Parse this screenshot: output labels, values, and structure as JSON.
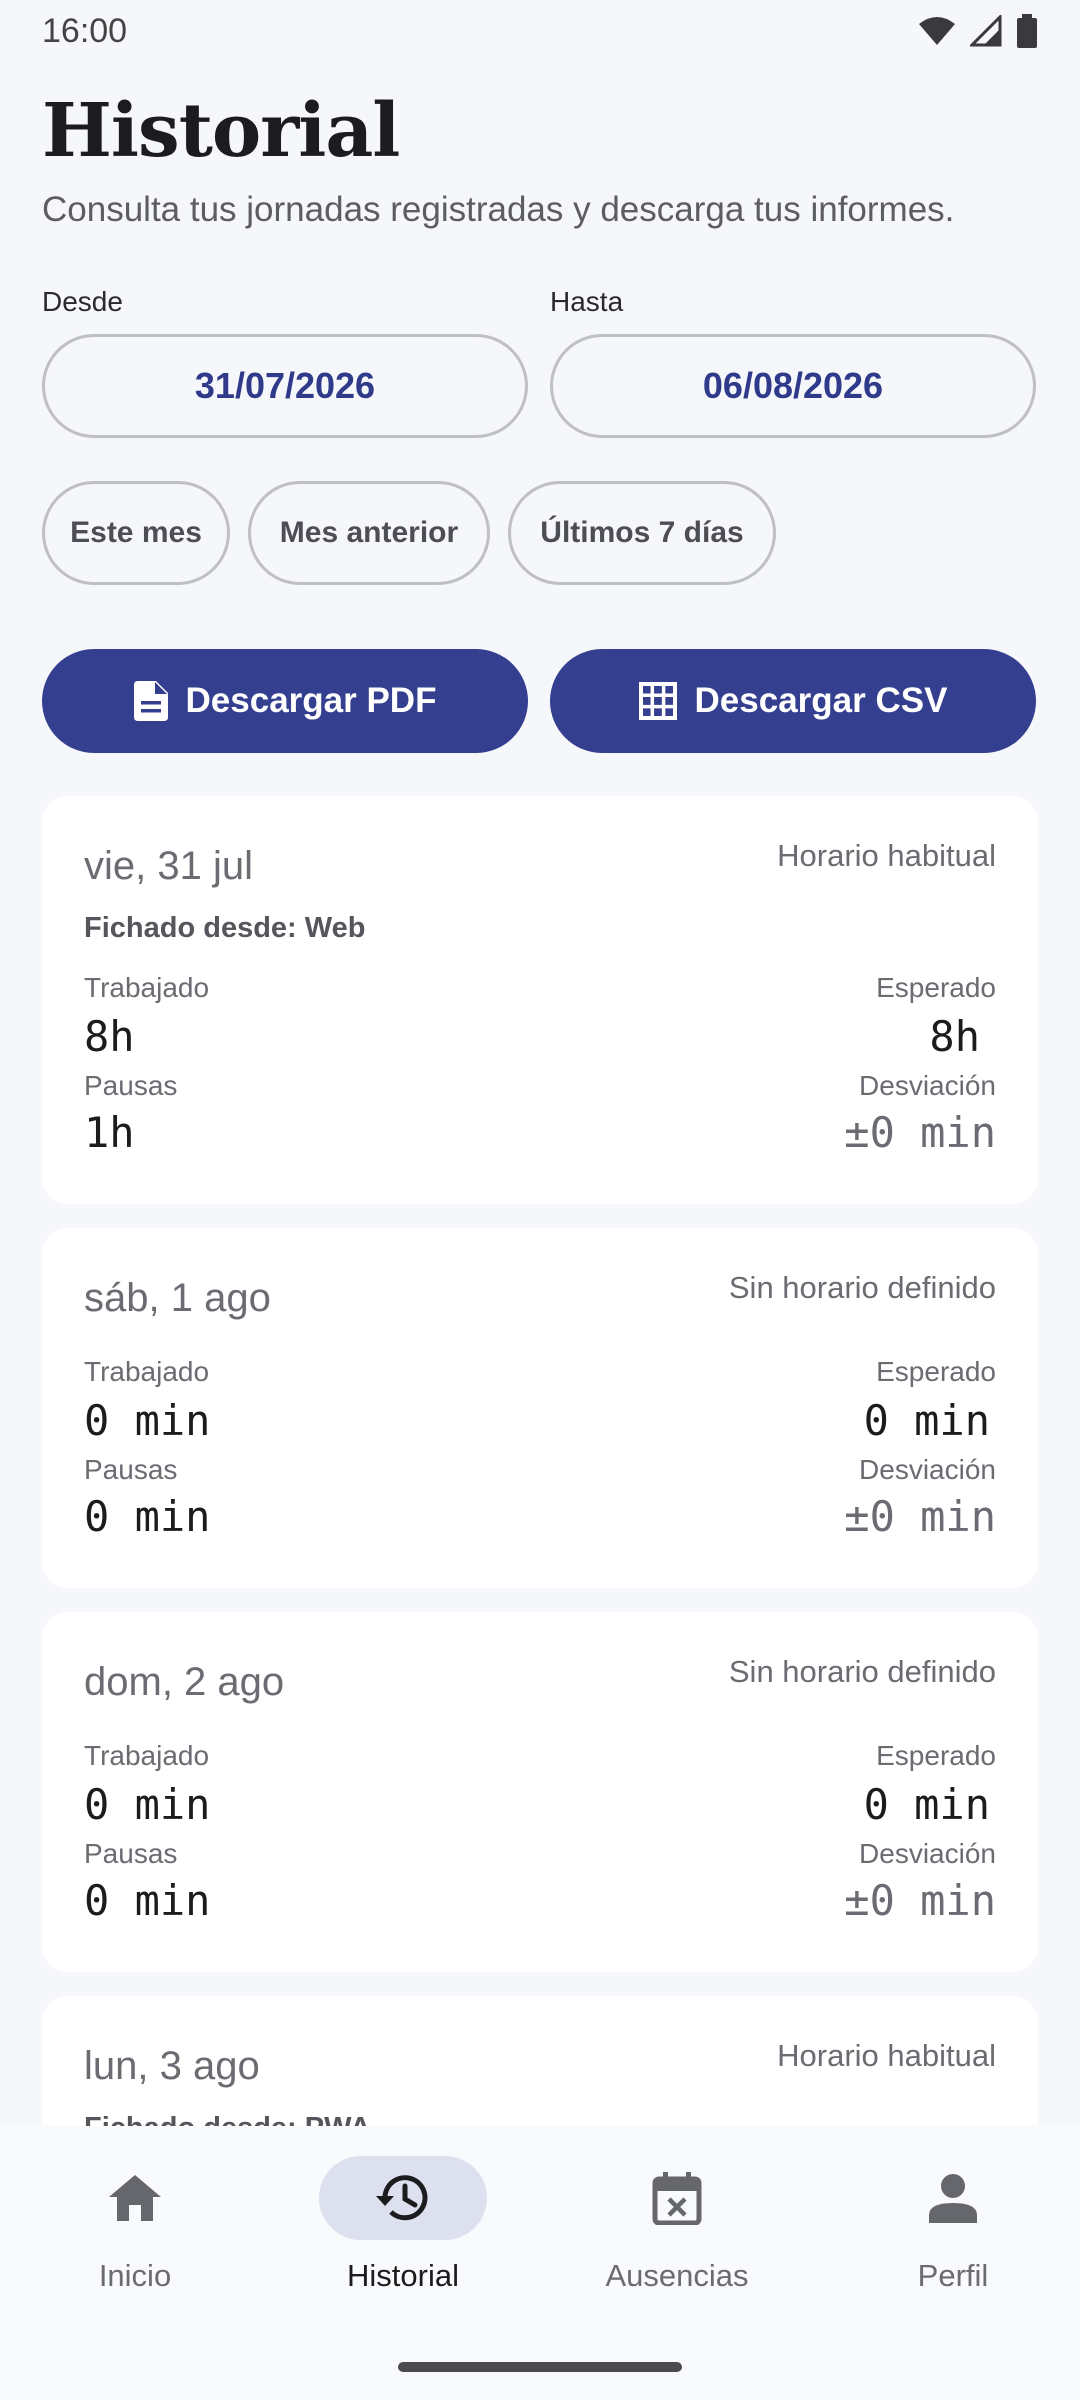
{
  "status_bar": {
    "time": "16:00"
  },
  "header": {
    "title": "Historial",
    "subtitle": "Consulta tus jornadas registradas y descarga tus informes."
  },
  "filters": {
    "from_label": "Desde",
    "from_value": "31/07/2026",
    "to_label": "Hasta",
    "to_value": "06/08/2026",
    "chips": [
      "Este mes",
      "Mes anterior",
      "Últimos 7 días"
    ]
  },
  "actions": {
    "pdf_label": "Descargar PDF",
    "csv_label": "Descargar CSV"
  },
  "labels": {
    "worked": "Trabajado",
    "expected": "Esperado",
    "breaks": "Pausas",
    "deviation": "Desviación"
  },
  "days": [
    {
      "date": "vie, 31 jul",
      "schedule": "Horario habitual",
      "source": "Fichado desde: Web",
      "worked": "8h",
      "expected": "8h",
      "breaks": "1h",
      "deviation": "±0 min"
    },
    {
      "date": "sáb, 1 ago",
      "schedule": "Sin horario definido",
      "worked": "0 min",
      "expected": "0 min",
      "breaks": "0 min",
      "deviation": "±0 min"
    },
    {
      "date": "dom, 2 ago",
      "schedule": "Sin horario definido",
      "worked": "0 min",
      "expected": "0 min",
      "breaks": "0 min",
      "deviation": "±0 min"
    },
    {
      "date": "lun, 3 ago",
      "schedule": "Horario habitual",
      "source": "Fichado desde: PWA"
    }
  ],
  "nav": {
    "items": [
      {
        "label": "Inicio",
        "icon": "home-icon"
      },
      {
        "label": "Historial",
        "icon": "history-icon"
      },
      {
        "label": "Ausencias",
        "icon": "calendar-cancel-icon"
      },
      {
        "label": "Perfil",
        "icon": "person-icon"
      }
    ],
    "active": "Historial"
  },
  "colors": {
    "primary": "#353f8f",
    "date_text": "#2f3a8a",
    "active_nav_bg": "#dde0ef",
    "background": "#f6f7fa"
  }
}
